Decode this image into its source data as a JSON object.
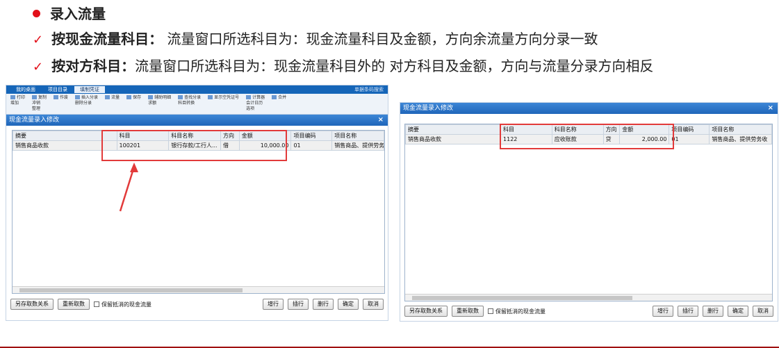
{
  "heading": "录入流量",
  "point1": {
    "bold": "按现金流量科目：",
    "text": " 流量窗口所选科目为：现金流量科目及金额，方向余流量方向分录一致"
  },
  "point2": {
    "bold": "按对方科目：",
    "text": "流量窗口所选科目为：现金流量科目外的 对方科目及金额，方向与流量分录方向相反"
  },
  "left_shot": {
    "tabs": [
      "我的桌面",
      "项目目录",
      "填制凭证"
    ],
    "search": "单据条码搜索",
    "tools": [
      "打印",
      "复制",
      "作废",
      "插入分录",
      "流量",
      "辅助明细",
      "查找分录",
      "显示空凭证号",
      "计算器",
      "合并",
      "增加",
      "冲销",
      "整理",
      "删除分录",
      "求额",
      "科目转换",
      "会计日历",
      "保存",
      "选项"
    ],
    "dialog_title": "现金流量录入修改",
    "columns": [
      "摘要",
      "科目",
      "科目名称",
      "方向",
      "金额",
      "项目编码",
      "项目名称"
    ],
    "row": [
      "销售商品收款",
      "100201",
      "银行存款/工行人...",
      "借",
      "10,000.00",
      "01",
      "销售商品、提供劳务收"
    ],
    "buttons": {
      "save_rel": "另存取数关系",
      "refetch": "重新取数",
      "keep": "保留抵消的现金流量",
      "add": "增行",
      "insert": "插行",
      "delete": "删行",
      "ok": "确定",
      "cancel": "取消"
    }
  },
  "right_shot": {
    "dialog_title": "现金流量录入修改",
    "columns": [
      "摘要",
      "科目",
      "科目名称",
      "方向",
      "金额",
      "项目编码",
      "项目名称"
    ],
    "row": [
      "销售商品收款",
      "1122",
      "应收账款",
      "贷",
      "2,000.00",
      "01",
      "销售商品、提供劳务收"
    ],
    "buttons": {
      "save_rel": "另存取数关系",
      "refetch": "重新取数",
      "keep": "保留抵消的现金流量",
      "add": "增行",
      "insert": "插行",
      "delete": "删行",
      "ok": "确定",
      "cancel": "取消"
    }
  },
  "colors": {
    "accent": "#e2101a",
    "dialog_blue": "#1f66ba",
    "highlight_red": "#e23a3a"
  }
}
